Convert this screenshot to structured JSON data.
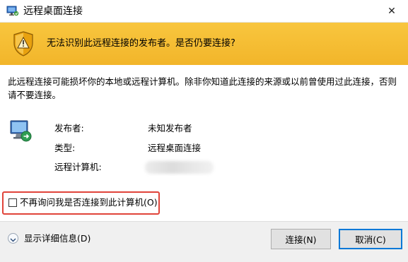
{
  "window": {
    "title": "远程桌面连接",
    "close_glyph": "✕"
  },
  "banner": {
    "message": "无法识别此远程连接的发布者。是否仍要连接?",
    "icon": "shield-warning-icon"
  },
  "description": "此远程连接可能损坏你的本地或远程计算机。除非你知道此连接的来源或以前曾使用过此连接，否则请不要连接。",
  "info": {
    "publisher_label": "发布者:",
    "publisher_value": "未知发布者",
    "type_label": "类型:",
    "type_value": "远程桌面连接",
    "computer_label": "远程计算机:",
    "computer_value_obscured": true
  },
  "checkbox": {
    "label": "不再询问我是否连接到此计算机(O)",
    "checked": false
  },
  "footer": {
    "details_label": "显示详细信息(D)",
    "connect_label": "连接(N)",
    "cancel_label": "取消(C)"
  },
  "colors": {
    "banner": "#f2b52a",
    "highlight": "#e0443a",
    "default_button_border": "#0078d7"
  }
}
